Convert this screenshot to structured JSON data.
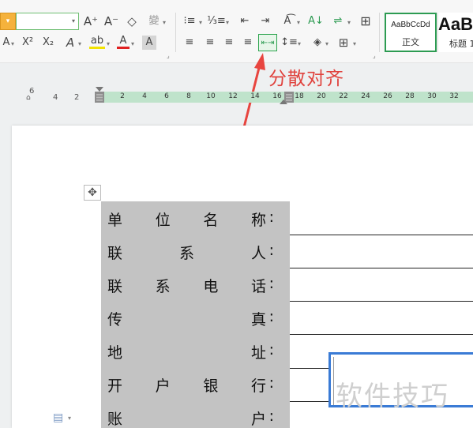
{
  "ribbon": {
    "font_size_dropdown_value": "",
    "row1": {
      "grow_font": "A⁺",
      "shrink_font": "A⁻",
      "clear_format": "◇",
      "phonetic": "變",
      "bullets": "⁝≡",
      "numbering": "⅓≡",
      "decrease_indent": "⇤",
      "increase_indent": "⇥",
      "text_direction": "A͡",
      "sort": "A↓",
      "line_break": "⇌",
      "table_grid": "⊞"
    },
    "row2": {
      "font_color_a": "A",
      "superscript": "X²",
      "subscript": "X₂",
      "text_effect": "A",
      "highlight": "ab",
      "font_color": "A",
      "char_shading": "A",
      "align_left": "≡",
      "align_center": "≡",
      "align_right": "≡",
      "justify": "≡",
      "distributed": "⇤⇥",
      "line_spacing": "↕≡",
      "shading": "◈",
      "borders": "⊞"
    },
    "styles": [
      {
        "sample": "AaBbCcDd",
        "name": "正文"
      },
      {
        "sample": "AaB",
        "name": "标题 1"
      }
    ]
  },
  "annotation": {
    "text": "分散对齐"
  },
  "ruler": {
    "left_numbers": [
      "6",
      "4",
      "2"
    ],
    "numbers": [
      "2",
      "4",
      "6",
      "8",
      "10",
      "12",
      "14",
      "16",
      "18",
      "20",
      "22",
      "24",
      "26",
      "28",
      "30",
      "32"
    ]
  },
  "document": {
    "labels": [
      {
        "chars": [
          "单",
          "位",
          "名",
          "称"
        ]
      },
      {
        "chars": [
          "联",
          "系",
          "人"
        ]
      },
      {
        "chars": [
          "联",
          "系",
          "电",
          "话"
        ]
      },
      {
        "chars": [
          "传",
          "真"
        ]
      },
      {
        "chars": [
          "地",
          "址"
        ]
      },
      {
        "chars": [
          "开",
          "户",
          "银",
          "行"
        ]
      },
      {
        "chars": [
          "账",
          "户"
        ]
      }
    ],
    "colon": ":",
    "watermark": "软件技巧"
  },
  "colors": {
    "accent_green": "#2d9b52",
    "annotation_red": "#e0423d",
    "label_bg": "#c3c3c3",
    "ruler_bg": "#bfe3cb",
    "textbox_border": "#3a7bd5"
  }
}
